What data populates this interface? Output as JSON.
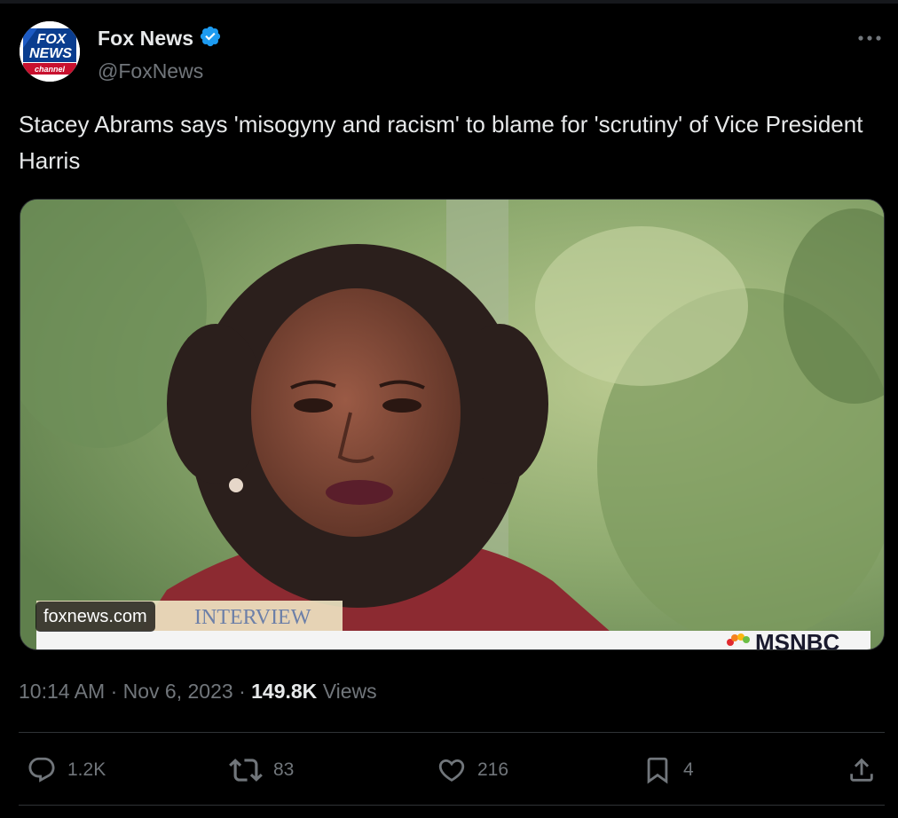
{
  "tweet": {
    "author": {
      "name": "Fox News",
      "handle": "@FoxNews",
      "verified": true,
      "avatar_logo": {
        "line1": "FOX",
        "line2": "NEWS",
        "line3": "channel"
      }
    },
    "text": "Stacey Abrams says 'misogyny and racism' to blame for 'scrutiny' of Vice President Harris",
    "media": {
      "source_label": "foxnews.com",
      "lower_third_tag": "INTERVIEW",
      "network_logo": "MSNBC"
    },
    "time": "10:14 AM",
    "date": "Nov 6, 2023",
    "views_count": "149.8K",
    "views_label": "Views",
    "separator": "·"
  },
  "actions": {
    "replies": "1.2K",
    "reposts": "83",
    "likes": "216",
    "bookmarks": "4"
  },
  "icons": [
    "verified-badge-icon",
    "more-icon",
    "reply-icon",
    "repost-icon",
    "like-icon",
    "bookmark-icon",
    "share-icon"
  ],
  "colors": {
    "background": "#000000",
    "text_primary": "#e7e9ea",
    "text_secondary": "#71767b",
    "verified_blue": "#1d9bf0",
    "divider": "#2f3336"
  }
}
